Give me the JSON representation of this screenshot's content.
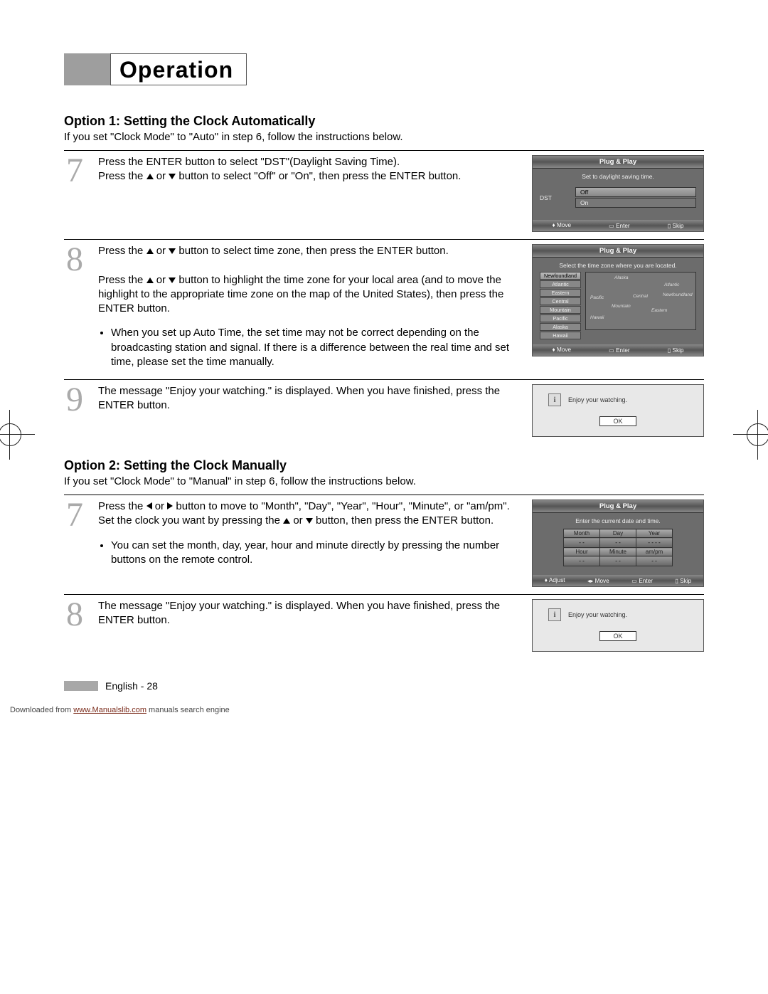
{
  "title": "Operation",
  "option1": {
    "heading": "Option 1: Setting the Clock Automatically",
    "intro": "If you set \"Clock Mode\" to \"Auto\" in step 6, follow the instructions below."
  },
  "option2": {
    "heading": "Option 2: Setting the Clock Manually",
    "intro": "If you set \"Clock Mode\" to \"Manual\" in step 6, follow the instructions below."
  },
  "steps": {
    "a7": {
      "num": "7",
      "p1": "Press the ENTER button to select \"DST\"(Daylight Saving Time).",
      "p2a": "Press the ",
      "p2b": " or ",
      "p2c": " button to select \"Off\" or \"On\", then press the ENTER button."
    },
    "a8": {
      "num": "8",
      "p1a": "Press the ",
      "p1b": " or ",
      "p1c": " button to select time zone, then press the ENTER button.",
      "p2a": "Press the ",
      "p2b": " or ",
      "p2c": " button to highlight the time zone for your local area (and to move the highlight to the appropriate time zone on the map of the United States), then press the ENTER button.",
      "bullet": "When you set up Auto Time, the set time may not be correct depending on the broadcasting station and signal. If there is a difference between the real time and set time, please set the time manually."
    },
    "a9": {
      "num": "9",
      "text": "The message \"Enjoy your watching.\" is displayed. When you have finished, press the ENTER button."
    },
    "b7": {
      "num": "7",
      "p1a": "Press the ",
      "p1b": " or ",
      "p1c": " button to move to \"Month\", \"Day\", \"Year\", \"Hour\", \"Minute\", or \"am/pm\".",
      "p2a": "Set the clock you want by pressing the ",
      "p2b": " or ",
      "p2c": " button, then press the ENTER button.",
      "bullet": "You can set the month, day, year, hour and minute directly by pressing the number buttons on the remote control."
    },
    "b8": {
      "num": "8",
      "text": "The message \"Enjoy your watching.\" is displayed. When you have finished, press the ENTER button."
    }
  },
  "osd": {
    "plugPlay": "Plug & Play",
    "dstHelp": "Set to daylight saving time.",
    "dstLabel": "DST",
    "optOff": "Off",
    "optOn": "On",
    "tzHelp": "Select the time zone where you are located.",
    "tz": [
      "Newfoundland",
      "Atlantic",
      "Eastern",
      "Central",
      "Mountain",
      "Pacific",
      "Alaska",
      "Hawaii"
    ],
    "map": {
      "alaska": "Alaska",
      "hawaii": "Hawaii",
      "pacific": "Pacific",
      "mountain": "Mountain",
      "central": "Central",
      "eastern": "Eastern",
      "atlantic": "Atlantic",
      "nfl": "Newfoundland"
    },
    "footMove": "Move",
    "footEnter": "Enter",
    "footSkip": "Skip",
    "footAdjust": "Adjust",
    "dateHelp": "Enter the current date and time.",
    "cols1": [
      "Month",
      "Day",
      "Year"
    ],
    "cols2": [
      "Hour",
      "Minute",
      "am/pm"
    ],
    "dash2": "- -",
    "dash4": "- - - -"
  },
  "dialog": {
    "msg": "Enjoy your watching.",
    "ok": "OK"
  },
  "footer": {
    "lang": "English - 28",
    "dl_pre": "Downloaded from ",
    "dl_link": "www.Manualslib.com",
    "dl_post": " manuals search engine"
  }
}
